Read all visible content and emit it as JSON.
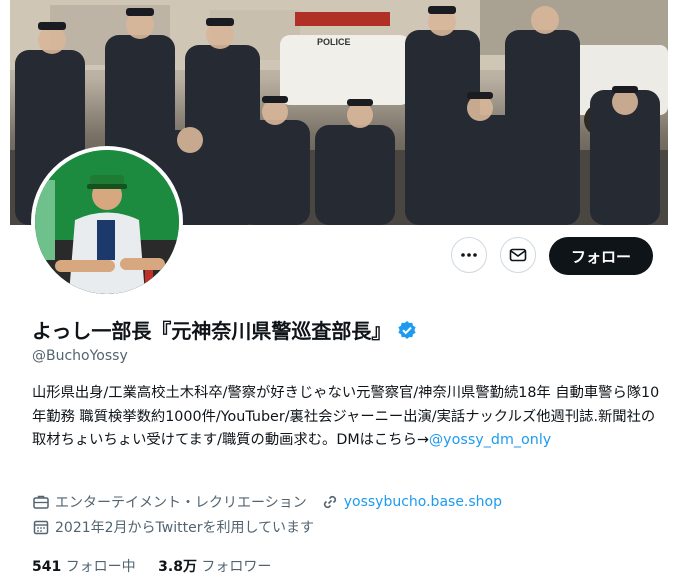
{
  "profile": {
    "display_name": "よっし一部長『元神奈川県警巡査部長』",
    "handle": "@BuchoYossy",
    "bio_text": "山形県出身/工業高校土木科卒/警察が好きじゃない元警察官/神奈川県警勤続18年 自動車警ら隊10年勤務 職質検挙数約1000件/YouTuber/裏社会ジャーニー出演/実話ナックルズ他週刊誌.新聞社の取材ちょいちょい受けてます/職質の動画求む。DMはこちら→",
    "bio_link": "@yossy_dm_only",
    "category": "エンターテイメント・レクリエーション",
    "website": "yossybucho.base.shop",
    "joined": "2021年2月からTwitterを利用しています",
    "following_count": "541",
    "following_label": "フォロー中",
    "followers_count": "3.8万",
    "followers_label": "フォロワー"
  },
  "banner": {
    "police_car_text": "POLICE"
  },
  "actions": {
    "more_icon": "more-dots-icon",
    "message_icon": "envelope-icon",
    "follow_label": "フォロー"
  },
  "colors": {
    "accent": "#1d9bf0",
    "follow_button": "#0f1419",
    "secondary_text": "#536471",
    "verified": "#1d9bf0"
  }
}
